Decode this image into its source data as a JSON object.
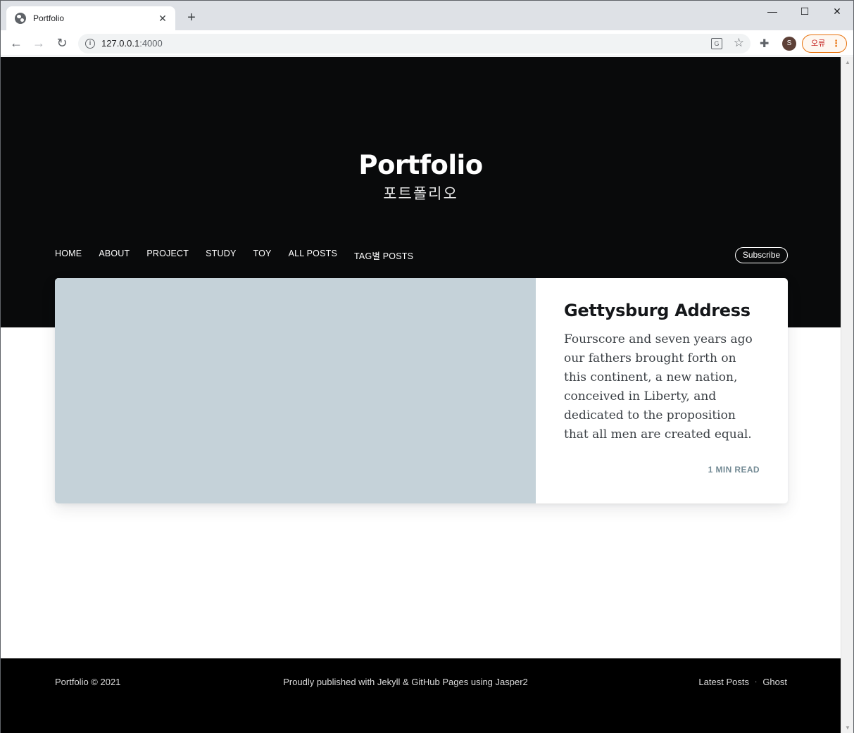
{
  "browser": {
    "tab_title": "Portfolio",
    "tab_close": "✕",
    "new_tab": "+",
    "url_host": "127.0.0.1",
    "url_port": ":4000",
    "profile_initial": "S",
    "error_label": "오류",
    "window_controls": {
      "minimize": "—",
      "maximize": "☐",
      "close": "✕"
    }
  },
  "site": {
    "title": "Portfolio",
    "description": "포트폴리오",
    "nav": [
      "HOME",
      "ABOUT",
      "PROJECT",
      "STUDY",
      "TOY",
      "ALL POSTS",
      "TAG별 POSTS"
    ],
    "subscribe_label": "Subscribe"
  },
  "post": {
    "title": "Gettysburg Address",
    "excerpt": "Fourscore and seven years ago our fathers brought forth on this continent, a new nation, conceived in Liberty, and dedicated to the proposition that all men are created equal.",
    "reading_time": "1 MIN READ",
    "image_color": "#c5d2d9"
  },
  "footer": {
    "copyright": "Portfolio © 2021",
    "credit": "Proudly published with Jekyll & GitHub Pages using Jasper2",
    "links": [
      "Latest Posts",
      "Ghost"
    ],
    "separator": "·"
  },
  "colors": {
    "hero_bg": "#090a0b",
    "footer_bg": "#000000",
    "meta_text": "#738a94"
  }
}
